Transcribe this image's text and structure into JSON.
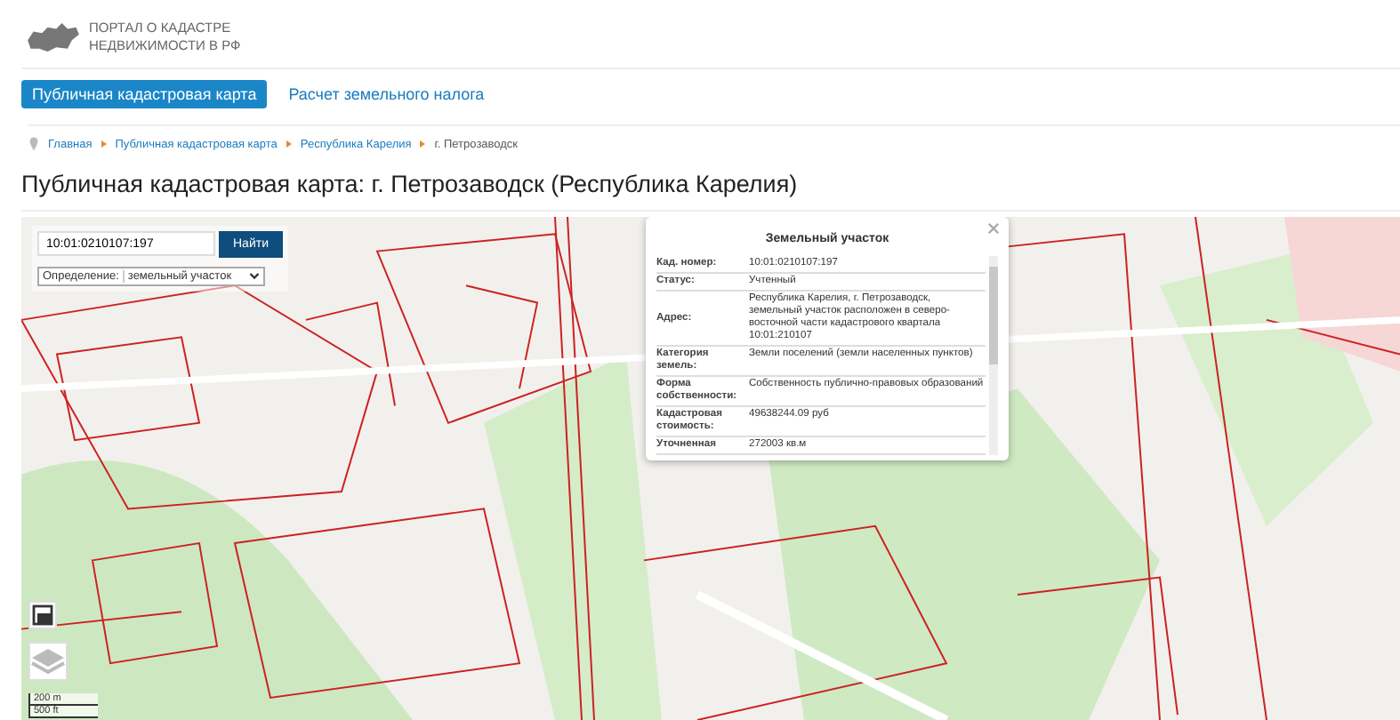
{
  "logo": {
    "line_1": "ПОРТАЛ О КАДАСТРЕ",
    "line_2": "НЕДВИЖИМОСТИ В РФ"
  },
  "tabs": [
    {
      "label": "Публичная кадастровая карта",
      "selected": true
    },
    {
      "label": "Расчет земельного налога",
      "selected": false
    }
  ],
  "breadcrumbs": [
    {
      "label": "Главная",
      "link": true
    },
    {
      "label": "Публичная кадастровая карта",
      "link": true
    },
    {
      "label": "Республика Карелия",
      "link": true
    },
    {
      "label": "г. Петрозаводск",
      "link": false
    }
  ],
  "page_title": "Публичная кадастровая карта: г. Петрозаводск (Республика Карелия)",
  "map": {
    "search": {
      "value": "10:01:0210107:197",
      "button": "Найти"
    },
    "definition": {
      "label": "Определение:",
      "value": "земельный участок"
    },
    "scale": [
      "200 m",
      "500 ft"
    ],
    "popup": {
      "title": "Земельный участок",
      "rows": [
        {
          "label": "Кад. номер:",
          "value": "10:01:0210107:197"
        },
        {
          "label": "Статус:",
          "value": "Учтенный"
        },
        {
          "label": "Адрес:",
          "value": "Республика Карелия, г. Петрозаводск, земельный участок расположен в северо-восточной части кадастрового квартала 10:01:210107"
        },
        {
          "label": "Категория земель:",
          "value": "Земли поселений (земли населенных пунктов)"
        },
        {
          "label": "Форма собственности:",
          "value": "Собственность публично-правовых образований"
        },
        {
          "label": "Кадастровая стоимость:",
          "value": "49638244.09 руб"
        },
        {
          "label": "Уточненная",
          "value": "272003 кв.м"
        }
      ]
    }
  }
}
